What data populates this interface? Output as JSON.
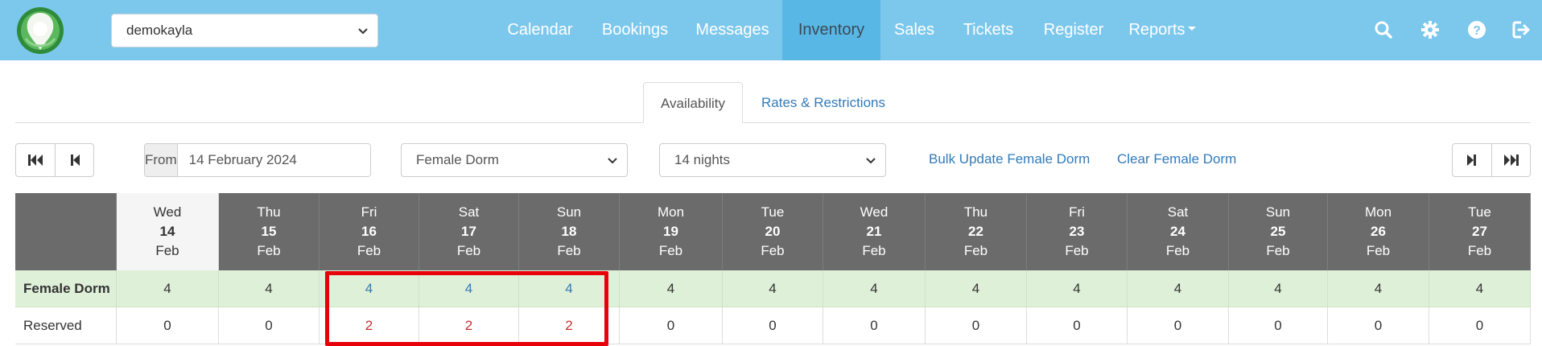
{
  "header": {
    "site_select": {
      "value": "demokayla"
    },
    "nav": [
      {
        "label": "Calendar",
        "active": false
      },
      {
        "label": "Bookings",
        "active": false
      },
      {
        "label": "Messages",
        "active": false
      },
      {
        "label": "Inventory",
        "active": true
      },
      {
        "label": "Sales",
        "active": false
      },
      {
        "label": "Tickets",
        "active": false
      },
      {
        "label": "Register",
        "active": false
      },
      {
        "label": "Reports",
        "active": false,
        "dropdown": true
      }
    ],
    "icons": [
      "search-icon",
      "gear-icon",
      "help-icon",
      "logout-icon"
    ]
  },
  "tabs": [
    {
      "label": "Availability",
      "active": true
    },
    {
      "label": "Rates & Restrictions",
      "active": false
    }
  ],
  "controls": {
    "from_label": "From",
    "from_value": "14 February 2024",
    "room_select": "Female Dorm",
    "nights_select": "14 nights",
    "bulk_update_link": "Bulk Update Female Dorm",
    "clear_link": "Clear Female Dorm"
  },
  "table": {
    "days": [
      {
        "dow": "Wed",
        "day": "14",
        "month": "Feb",
        "today": true
      },
      {
        "dow": "Thu",
        "day": "15",
        "month": "Feb"
      },
      {
        "dow": "Fri",
        "day": "16",
        "month": "Feb"
      },
      {
        "dow": "Sat",
        "day": "17",
        "month": "Feb"
      },
      {
        "dow": "Sun",
        "day": "18",
        "month": "Feb"
      },
      {
        "dow": "Mon",
        "day": "19",
        "month": "Feb"
      },
      {
        "dow": "Tue",
        "day": "20",
        "month": "Feb"
      },
      {
        "dow": "Wed",
        "day": "21",
        "month": "Feb"
      },
      {
        "dow": "Thu",
        "day": "22",
        "month": "Feb"
      },
      {
        "dow": "Fri",
        "day": "23",
        "month": "Feb"
      },
      {
        "dow": "Sat",
        "day": "24",
        "month": "Feb"
      },
      {
        "dow": "Sun",
        "day": "25",
        "month": "Feb"
      },
      {
        "dow": "Mon",
        "day": "26",
        "month": "Feb"
      },
      {
        "dow": "Tue",
        "day": "27",
        "month": "Feb"
      }
    ],
    "availability_label": "Female Dorm",
    "availability": [
      "4",
      "4",
      "4",
      "4",
      "4",
      "4",
      "4",
      "4",
      "4",
      "4",
      "4",
      "4",
      "4",
      "4"
    ],
    "reserved_label": "Reserved",
    "reserved": [
      "0",
      "0",
      "2",
      "2",
      "2",
      "0",
      "0",
      "0",
      "0",
      "0",
      "0",
      "0",
      "0",
      "0"
    ]
  },
  "colors": {
    "nav_bg": "#7cc7ec",
    "nav_active": "#58b7e5",
    "link": "#337ab7",
    "header_cell": "#6b6b6b",
    "avail_bg": "#dff0d8",
    "reserved_highlight": "#c9302c",
    "annotation_box": "#e8000b"
  }
}
